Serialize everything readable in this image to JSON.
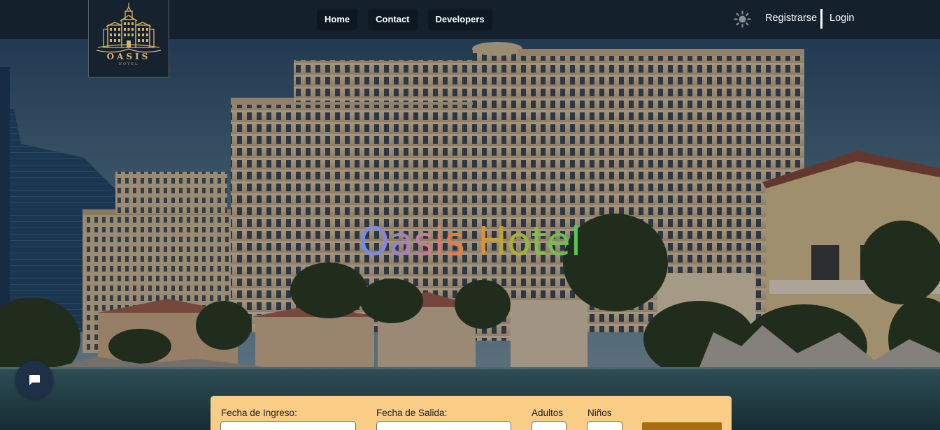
{
  "brand": {
    "name": "OASIS",
    "tagline": "HOTEL"
  },
  "nav": {
    "links": [
      "Home",
      "Contact",
      "Developers"
    ]
  },
  "auth": {
    "register": "Registrarse",
    "login": "Login"
  },
  "hero": {
    "title": "Oasis Hotel"
  },
  "booking": {
    "checkin_label": "Fecha de Ingreso:",
    "checkout_label": "Fecha de Salida:",
    "adults_label": "Adultos",
    "children_label": "Niños"
  },
  "icons": {
    "theme": "sun-icon",
    "chat": "chat-icon"
  },
  "colors": {
    "navbar": "#14202c",
    "form_bg": "#f9cd86",
    "search_button": "#a86e0e",
    "chat_bubble": "#1e3048"
  }
}
